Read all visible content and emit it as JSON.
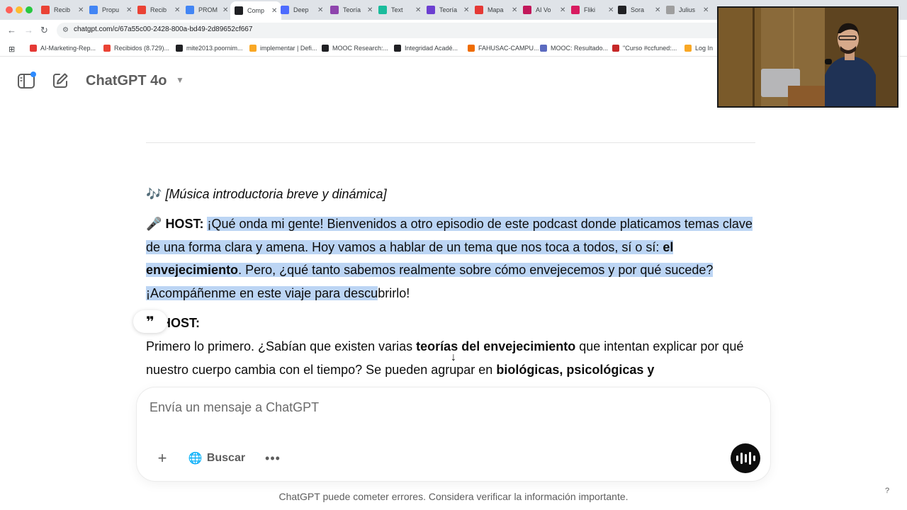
{
  "browser": {
    "tabs": [
      {
        "label": "Recib",
        "color": "#ea4335"
      },
      {
        "label": "Propu",
        "color": "#4285f4"
      },
      {
        "label": "Recib",
        "color": "#ea4335"
      },
      {
        "label": "PROM",
        "color": "#4285f4"
      },
      {
        "label": "Comp",
        "color": "#202124"
      },
      {
        "label": "Deep",
        "color": "#4d6bfe"
      },
      {
        "label": "Teoría",
        "color": "#8e44ad"
      },
      {
        "label": "Text",
        "color": "#1abc9c"
      },
      {
        "label": "Teoría",
        "color": "#6c3fd1"
      },
      {
        "label": "Mapa",
        "color": "#e53935"
      },
      {
        "label": "AI Vo",
        "color": "#c2185b"
      },
      {
        "label": "Fliki",
        "color": "#d81b60"
      },
      {
        "label": "Sora",
        "color": "#202124"
      },
      {
        "label": "Julius",
        "color": "#9e9e9e"
      }
    ],
    "url": "chatgpt.com/c/67a55c00-2428-800a-bd49-2d89652cf667",
    "bookmarks": [
      {
        "label": "AI-Marketing-Rep...",
        "color": "#e53935"
      },
      {
        "label": "Recibidos (8.729)...",
        "color": "#ea4335"
      },
      {
        "label": "mite2013.poornim...",
        "color": "#202124"
      },
      {
        "label": "implementar | Defi...",
        "color": "#f9a825"
      },
      {
        "label": "MOOC Research:...",
        "color": "#202124"
      },
      {
        "label": "Integridad Acadé...",
        "color": "#202124"
      },
      {
        "label": "FAHUSAC-CAMPU...",
        "color": "#ef6c00"
      },
      {
        "label": "MOOC: Resultado...",
        "color": "#5c6bc0"
      },
      {
        "label": "\"Curso #ccfuned:...",
        "color": "#c62828"
      },
      {
        "label": "Log In",
        "color": "#f9a825"
      }
    ]
  },
  "header": {
    "model_title": "ChatGPT 4o"
  },
  "message": {
    "intro_emoji": "🎶",
    "intro_text": "[Música introductoria breve y dinámica]",
    "mic_emoji": "🎤",
    "host_label": "HOST:",
    "p1_hl_a": "¡Qué onda mi gente! Bienvenidos a otro episodio de este podcast donde platicamos temas clave de una forma clara y amena. Hoy vamos a hablar de un tema que nos toca a todos, sí o sí: ",
    "p1_hl_bold": "el envejecimiento",
    "p1_hl_b": ". Pero, ¿qué tanto sabemos realmente sobre cómo envejecemos y por qué sucede? ¡Acompáñenme en este viaje para descu",
    "p1_plain": "brirlo!",
    "host_label_2": "HOST:",
    "p2_a": "Primero lo primero. ¿Sabían que existen varias ",
    "p2_bold_a": "teorías del envejecimiento",
    "p2_b": " que intentan explicar por qué nuestro cuerpo cambia con el tiempo? Se pueden agrupar en ",
    "p2_bold_b": "biológicas, psicológicas y"
  },
  "composer": {
    "placeholder": "Envía un mensaje a ChatGPT",
    "search_label": "Buscar"
  },
  "footer": {
    "disclaimer": "ChatGPT puede cometer errores. Considera verificar la información importante.",
    "help": "?"
  }
}
